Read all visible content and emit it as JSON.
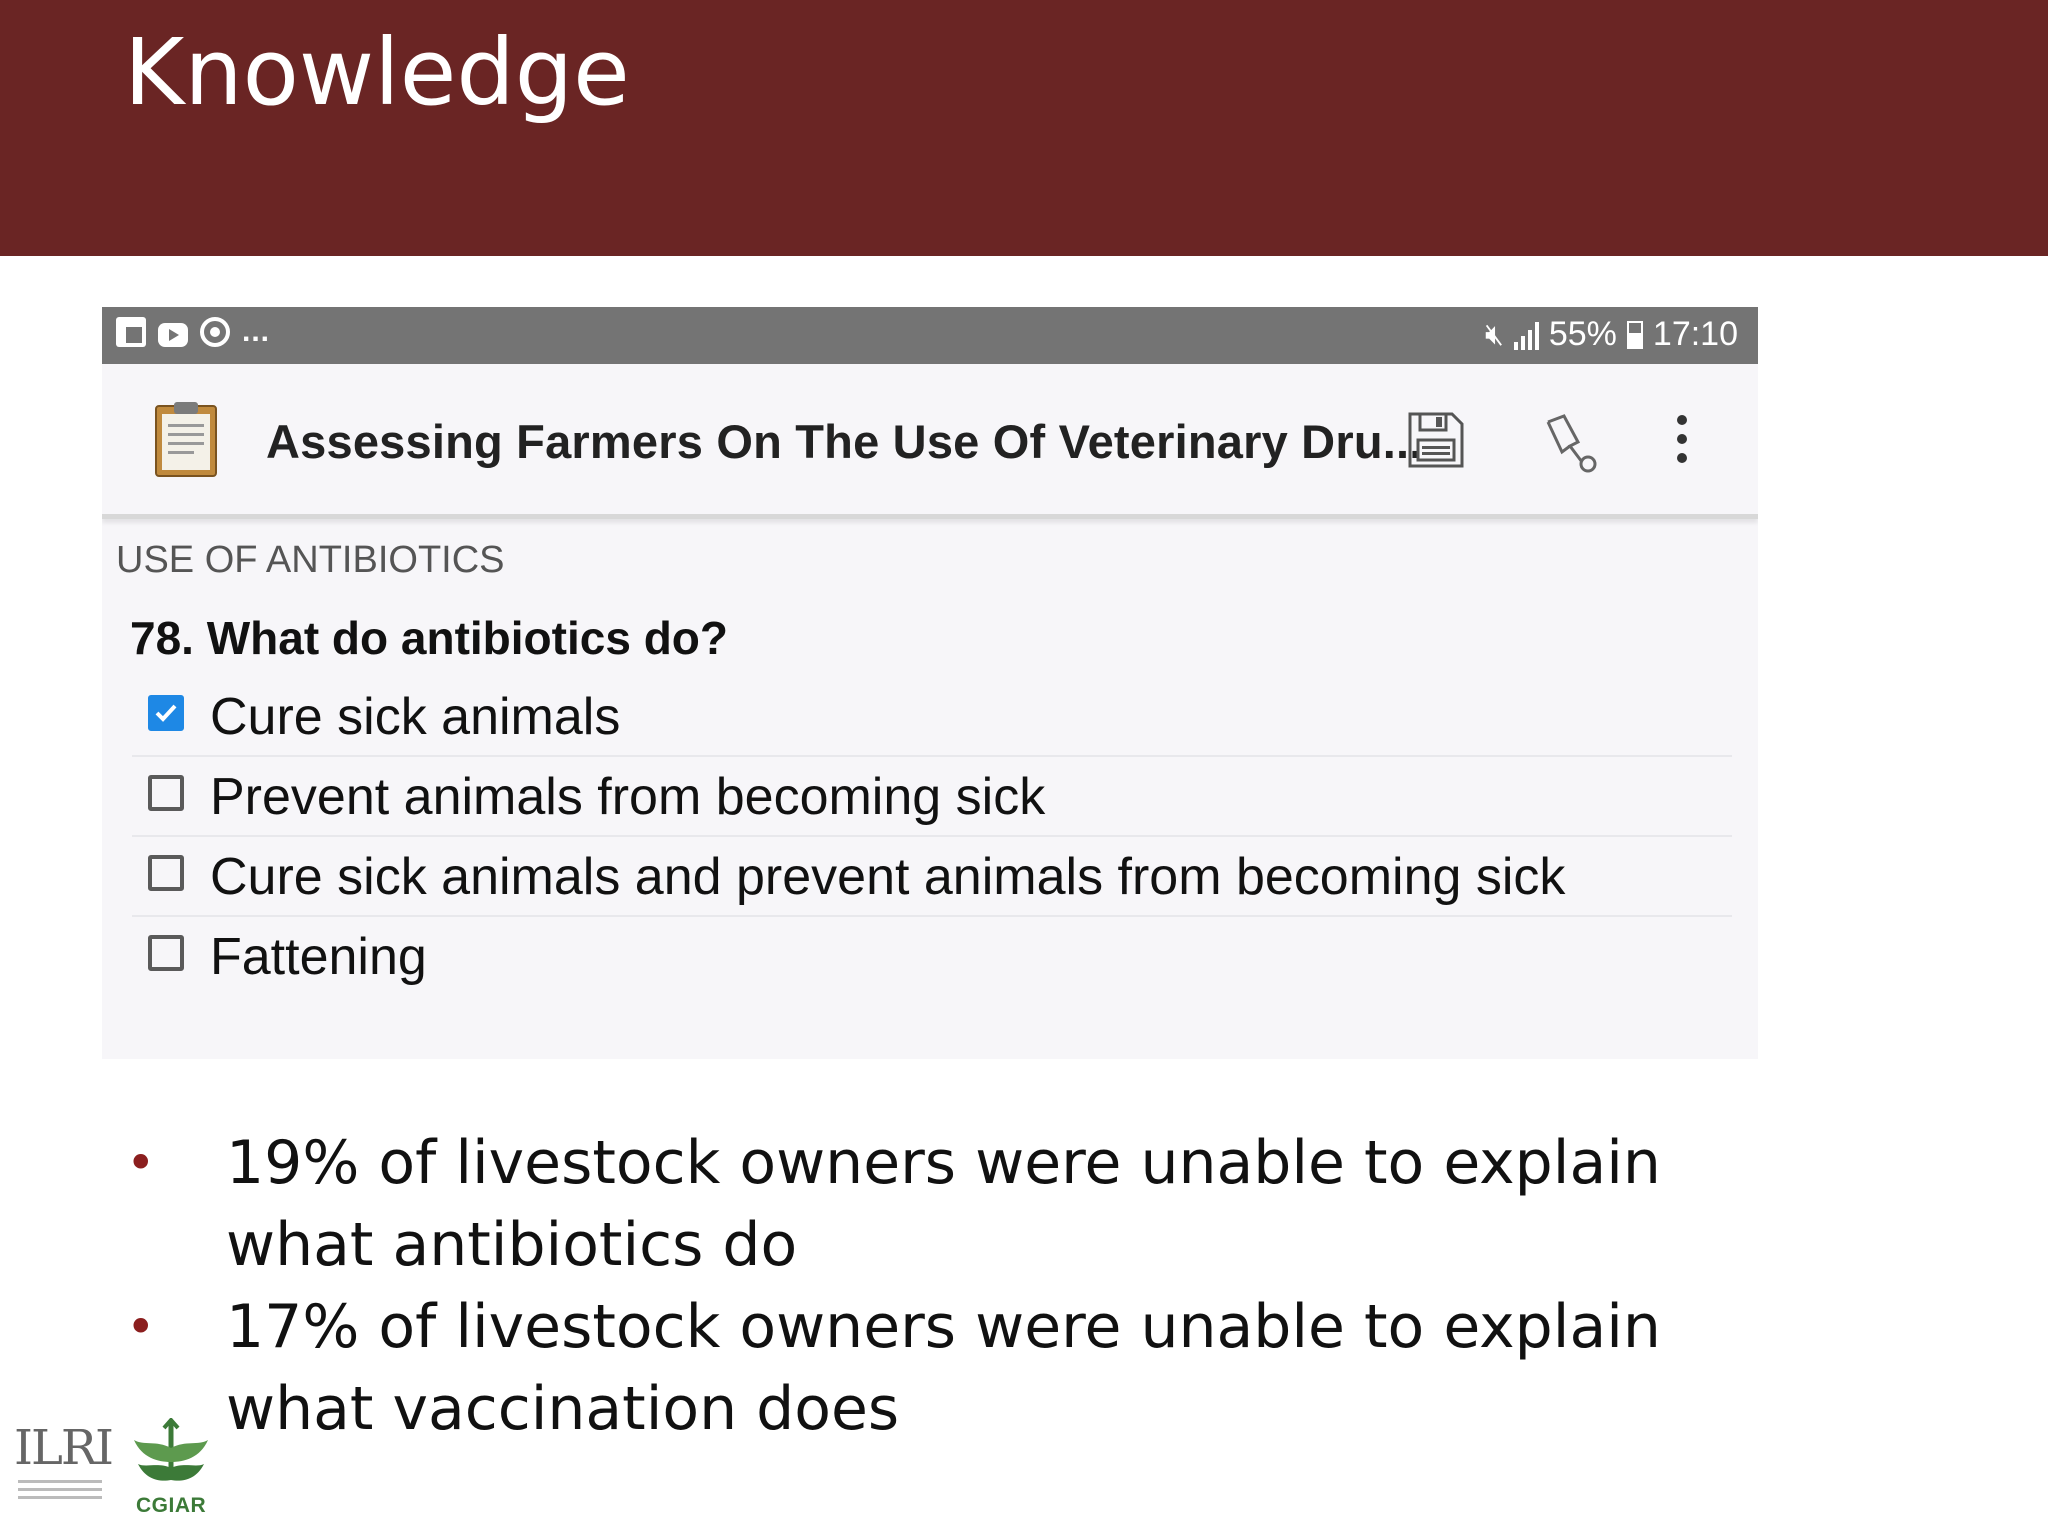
{
  "slide": {
    "title": "Knowledge"
  },
  "status_bar": {
    "overflow": "...",
    "battery": "55%",
    "time": "17:10"
  },
  "app_bar": {
    "title": "Assessing Farmers On The Use Of Veterinary Dru..."
  },
  "form": {
    "section": "USE OF ANTIBIOTICS",
    "question": "78. What do antibiotics do?",
    "options": [
      {
        "label": "Cure sick animals",
        "checked": true
      },
      {
        "label": "Prevent animals from becoming sick",
        "checked": false
      },
      {
        "label": "Cure sick animals and prevent animals from becoming sick",
        "checked": false
      },
      {
        "label": "Fattening",
        "checked": false
      }
    ]
  },
  "bullets": [
    "19% of livestock owners were unable to explain what antibiotics do",
    "17% of livestock owners were unable to explain what vaccination does"
  ],
  "bullet_symbol": "•",
  "logos": {
    "ilri": "ILRI",
    "cgiar": "CGIAR"
  },
  "colors": {
    "title_bar": "#6a2524",
    "checkbox_checked": "#1e88e5",
    "bullet": "#8b1e1e",
    "cgiar_green": "#3c7a38"
  }
}
